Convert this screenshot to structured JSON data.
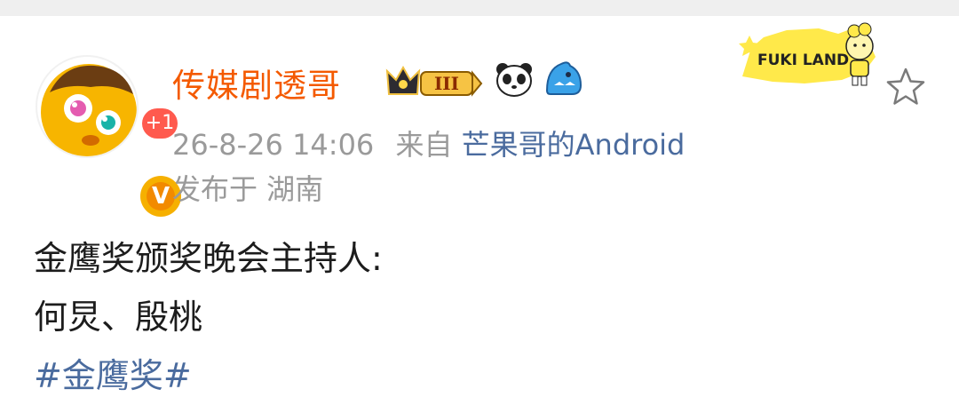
{
  "user": {
    "name": "传媒剧透哥",
    "notification_count": "+1",
    "verified_label": "V",
    "vip_level": "III"
  },
  "meta": {
    "timestamp": "26-8-26 14:06",
    "from_prefix": "来自",
    "source": "芒果哥的Android",
    "location": "发布于 湖南"
  },
  "post": {
    "lines": [
      "金鹰奖颁奖晚会主持人:",
      "何炅、殷桃"
    ],
    "hashtag": "#金鹰奖#"
  },
  "decoration": {
    "card_text": "FUKI LAND"
  },
  "colors": {
    "username": "#f45a00",
    "link": "#4a6b9e",
    "meta": "#9a9a9a",
    "text": "#1c1c1c",
    "badge_red": "#ff5a4e"
  },
  "icons": [
    "avatar-icon",
    "crown-vip-icon",
    "panda-icon",
    "shark-icon",
    "star-icon"
  ]
}
